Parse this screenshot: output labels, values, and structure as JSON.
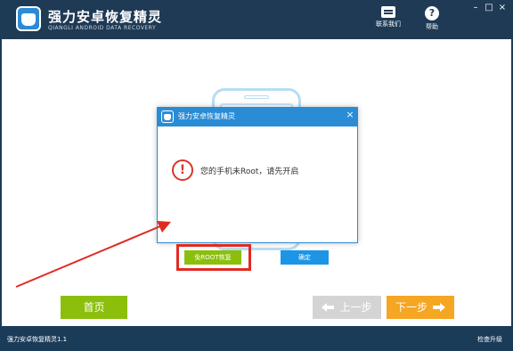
{
  "app": {
    "title": "强力安卓恢复精灵",
    "subtitle": "QIANGLI ANDROID DATA RECOVERY"
  },
  "toolbar": {
    "contact_label": "联系我们",
    "help_label": "帮助",
    "contact_icon": "chat-icon",
    "help_icon": "question-icon"
  },
  "window_controls": {
    "minimize": "–",
    "maximize": "□",
    "close": "×"
  },
  "dialog": {
    "title": "强力安卓恢复精灵",
    "close": "×",
    "warning_icon": "!",
    "message": "您的手机未Root，请先开启",
    "no_root_button": "免ROOT恢复",
    "ok_button": "确定"
  },
  "nav": {
    "home": "首页",
    "prev": "上一步",
    "next": "下一步"
  },
  "status": {
    "version": "强力安卓恢复精灵1.1",
    "update": "检查升级"
  },
  "colors": {
    "titlebar": "#1f3a55",
    "dialog_accent": "#2a8cd5",
    "green": "#8bbf0c",
    "orange": "#f5a623",
    "disabled": "#d4d4d4",
    "highlight_red": "#e02a22"
  }
}
